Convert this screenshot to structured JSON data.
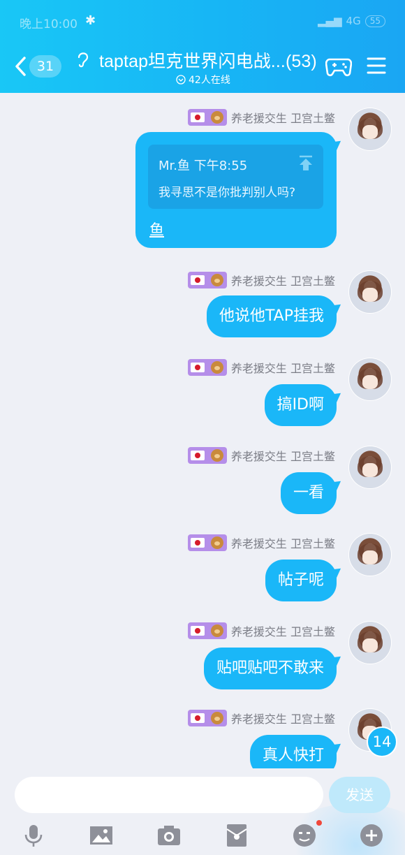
{
  "status": {
    "time": "晚上10:00",
    "network": "4G",
    "battery": "55"
  },
  "header": {
    "back_count": "31",
    "title": "taptap坦克世界闪电战...(53)",
    "online": "42人在线"
  },
  "messages": [
    {
      "sender": "养老援交生 卫宫土鳖",
      "type": "quote",
      "quote_author": "Mr.鱼 下午8:55",
      "quote_text": "我寻思不是你批判别人吗?",
      "text": "鱼"
    },
    {
      "sender": "养老援交生 卫宫土鳖",
      "text": "他说他TAP挂我"
    },
    {
      "sender": "养老援交生 卫宫土鳖",
      "text": "搞ID啊"
    },
    {
      "sender": "养老援交生 卫宫土鳖",
      "text": "一看"
    },
    {
      "sender": "养老援交生 卫宫土鳖",
      "text": "帖子呢"
    },
    {
      "sender": "养老援交生 卫宫土鳖",
      "text": "贴吧贴吧不敢来"
    },
    {
      "sender": "养老援交生 卫宫土鳖",
      "text": "真人快打"
    }
  ],
  "unread_count": "14",
  "input": {
    "placeholder": "",
    "send_label": "发送"
  },
  "toolbar": [
    "microphone-icon",
    "image-icon",
    "camera-icon",
    "red-packet-icon",
    "emoji-icon",
    "plus-icon"
  ],
  "colors": {
    "header": "#19c7f6",
    "bubble": "#1ab7f8",
    "badge": "#b58ee9",
    "background": "#eef0f6"
  }
}
